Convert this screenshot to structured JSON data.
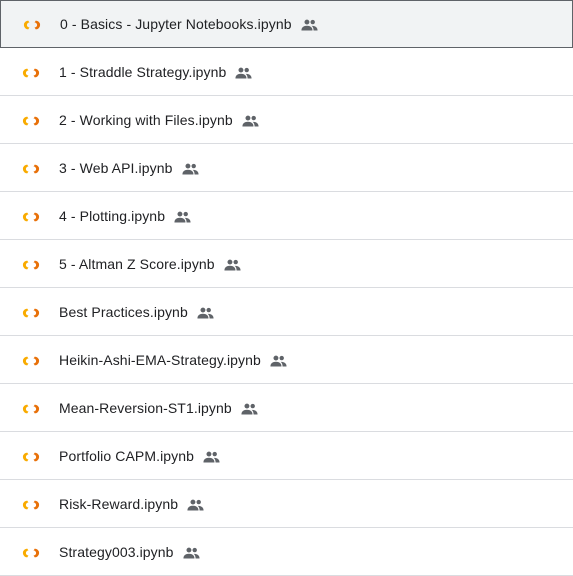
{
  "files": {
    "items": [
      {
        "name": "0 - Basics - Jupyter Notebooks.ipynb",
        "selected": true
      },
      {
        "name": "1 - Straddle Strategy.ipynb",
        "selected": false
      },
      {
        "name": "2 - Working with Files.ipynb",
        "selected": false
      },
      {
        "name": "3 - Web API.ipynb",
        "selected": false
      },
      {
        "name": "4 - Plotting.ipynb",
        "selected": false
      },
      {
        "name": "5 - Altman Z Score.ipynb",
        "selected": false
      },
      {
        "name": "Best Practices.ipynb",
        "selected": false
      },
      {
        "name": "Heikin-Ashi-EMA-Strategy.ipynb",
        "selected": false
      },
      {
        "name": "Mean-Reversion-ST1.ipynb",
        "selected": false
      },
      {
        "name": "Portfolio CAPM.ipynb",
        "selected": false
      },
      {
        "name": "Risk-Reward.ipynb",
        "selected": false
      },
      {
        "name": "Strategy003.ipynb",
        "selected": false
      }
    ],
    "file_icon": "colab-notebook-icon",
    "shared_icon": "people-shared-icon"
  },
  "colors": {
    "colab_orange": "#F9AB00",
    "colab_dark_orange": "#E8710A",
    "shared_icon": "#5f6368",
    "divider": "#dadce0",
    "selected_border": "#5f6368",
    "text": "#202124"
  }
}
